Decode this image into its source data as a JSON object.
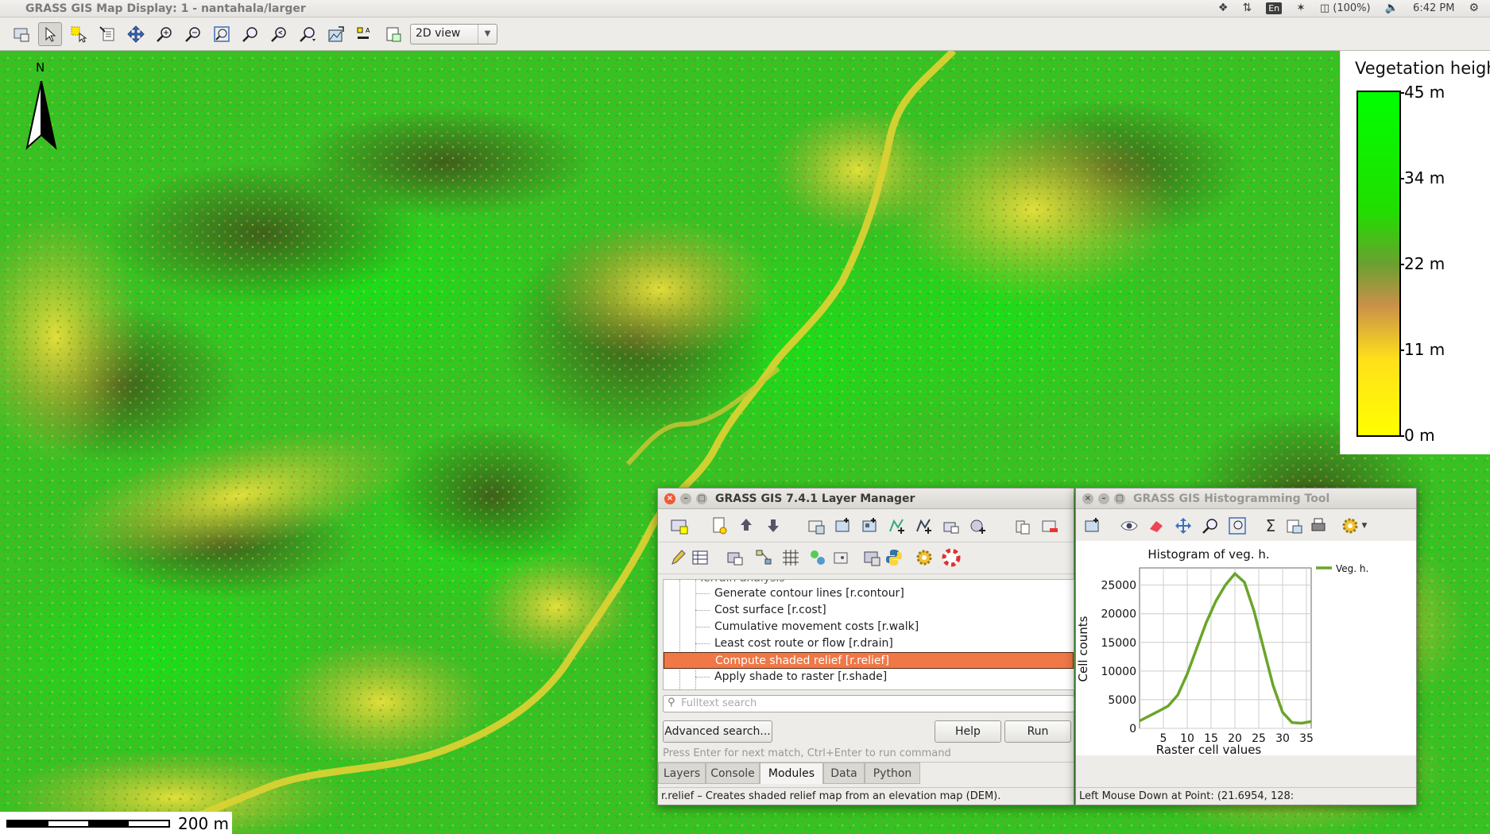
{
  "top_panel": {
    "title": "GRASS GIS Map Display: 1 - nantahala/larger",
    "battery": "(100%)",
    "lang": "En",
    "time": "6:42 PM"
  },
  "map_toolbar": {
    "view_mode": "2D view",
    "icons": [
      "display-map-icon",
      "pointer-icon",
      "query-icon",
      "analyze-icon",
      "pan-icon",
      "zoom-in-icon",
      "zoom-out-icon",
      "zoom-extent-icon",
      "zoom-region-icon",
      "zoom-back-icon",
      "zoom-menu-icon",
      "map-output-icon",
      "decoration-icon",
      "save-display-icon"
    ]
  },
  "map": {
    "north_label": "N",
    "legend": {
      "title": "Vegetation height",
      "ticks": [
        "45 m",
        "34 m",
        "22 m",
        "11 m",
        "0 m"
      ],
      "colors": {
        "high": "#00ff00",
        "mid": "#c9904a",
        "low": "#ffff00"
      }
    },
    "scale_label": "200 m"
  },
  "layer_manager": {
    "title": "GRASS GIS 7.4.1 Layer Manager",
    "tree_items": [
      {
        "label": "Terrain analysis",
        "selected": false
      },
      {
        "label": "Generate contour lines  [r.contour]",
        "selected": false
      },
      {
        "label": "Cost surface  [r.cost]",
        "selected": false
      },
      {
        "label": "Cumulative movement costs  [r.walk]",
        "selected": false
      },
      {
        "label": "Least cost route or flow  [r.drain]",
        "selected": false
      },
      {
        "label": "Compute shaded relief  [r.relief]",
        "selected": true
      },
      {
        "label": "Apply shade to raster  [r.shade]",
        "selected": false
      }
    ],
    "search_placeholder": "Fulltext search",
    "advanced_search": "Advanced search...",
    "help": "Help",
    "run": "Run",
    "hint": "Press Enter for next match, Ctrl+Enter to run command",
    "tabs": [
      "Layers",
      "Console",
      "Modules",
      "Data",
      "Python"
    ],
    "active_tab": "Modules",
    "status": "r.relief – Creates shaded relief map from an elevation map (DEM)."
  },
  "histogram_tool": {
    "title": "GRASS GIS Histogramming Tool",
    "status": "Left Mouse Down at Point: (21.6954, 128:"
  },
  "chart_data": {
    "type": "line",
    "title": "Histogram of veg. h.",
    "xlabel": "Raster cell values",
    "ylabel": "Cell counts",
    "xlim": [
      0,
      36
    ],
    "ylim": [
      0,
      28000
    ],
    "xticks": [
      5,
      10,
      15,
      20,
      25,
      30,
      35
    ],
    "yticks": [
      0,
      5000,
      10000,
      15000,
      20000,
      25000
    ],
    "grid": true,
    "legend_position": "top-right",
    "series": [
      {
        "name": "Veg. h.",
        "color": "#6aa52a",
        "x": [
          0,
          4,
          6,
          8,
          10,
          12,
          14,
          16,
          18,
          20,
          22,
          24,
          26,
          28,
          30,
          32,
          34,
          36
        ],
        "y": [
          1300,
          3000,
          3900,
          5800,
          9500,
          14000,
          18500,
          22200,
          25000,
          27000,
          25500,
          20500,
          14000,
          7500,
          2800,
          1000,
          900,
          1200
        ]
      }
    ]
  }
}
